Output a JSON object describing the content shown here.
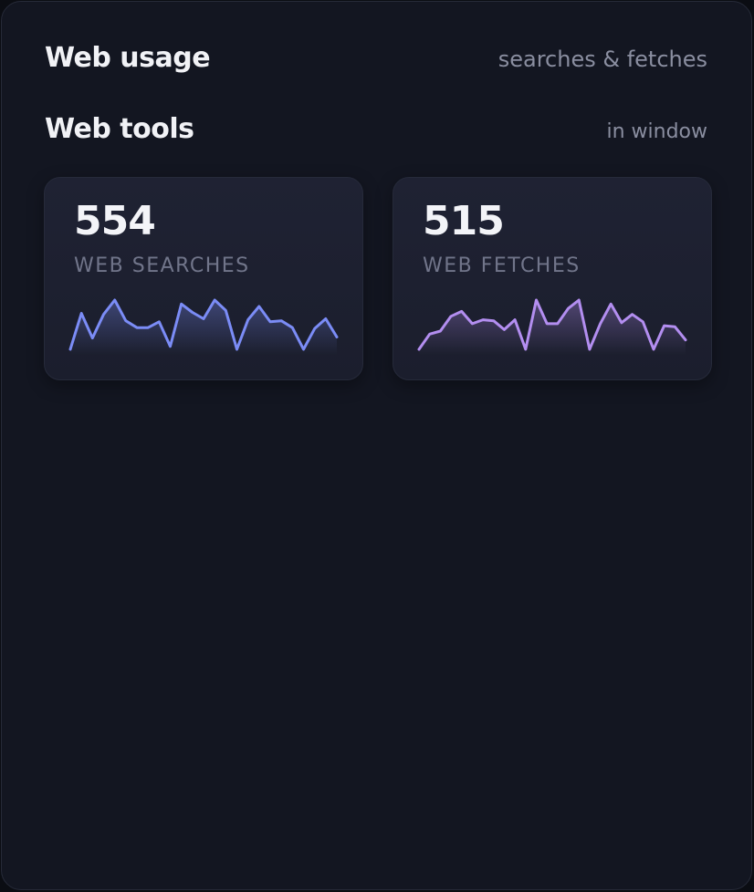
{
  "widget": {
    "title": "Web usage",
    "subtitle": "searches & fetches"
  },
  "section": {
    "title": "Web tools",
    "scope": "in window"
  },
  "cards": [
    {
      "value": "554",
      "label": "WEB SEARCHES",
      "color": "#7b8cf6",
      "series": [
        0.0,
        0.73,
        0.23,
        0.71,
        1.0,
        0.58,
        0.44,
        0.44,
        0.56,
        0.06,
        0.92,
        0.75,
        0.62,
        1.0,
        0.79,
        0.0,
        0.6,
        0.87,
        0.56,
        0.58,
        0.44,
        0.0,
        0.42,
        0.62,
        0.25
      ]
    },
    {
      "value": "515",
      "label": "WEB FETCHES",
      "color": "#b38ef0",
      "series": [
        0.0,
        0.31,
        0.37,
        0.67,
        0.77,
        0.52,
        0.6,
        0.58,
        0.4,
        0.6,
        0.0,
        1.0,
        0.52,
        0.52,
        0.83,
        1.0,
        0.0,
        0.52,
        0.92,
        0.54,
        0.71,
        0.56,
        0.0,
        0.48,
        0.46,
        0.19
      ]
    }
  ]
}
